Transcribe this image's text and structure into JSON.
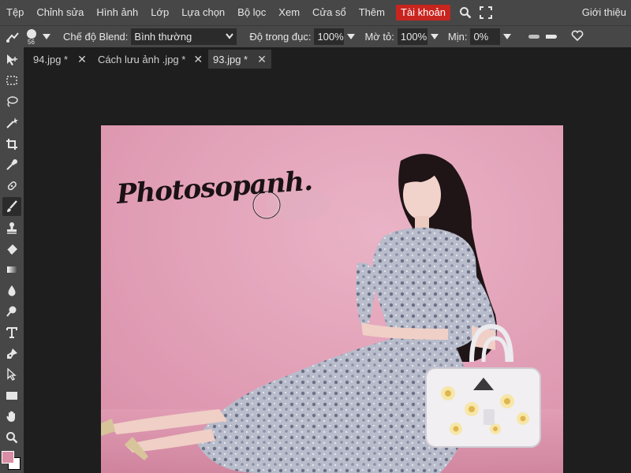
{
  "menu": {
    "items": [
      "Tệp",
      "Chỉnh sửa",
      "Hình ảnh",
      "Lớp",
      "Lựa chọn",
      "Bộ lọc",
      "Xem",
      "Cửa sổ",
      "Thêm"
    ],
    "account": "Tài khoản",
    "about": "Giới thiệu"
  },
  "options": {
    "brush_size": "56",
    "blend_label": "Chế độ Blend:",
    "blend_value": "Bình thường",
    "opacity_label": "Độ trong đục:",
    "opacity_value": "100%",
    "flow_label": "Mờ tỏ:",
    "flow_value": "100%",
    "smooth_label": "Mịn:",
    "smooth_value": "0%"
  },
  "tabs": [
    {
      "label": "94.jpg *"
    },
    {
      "label": "Cách lưu ảnh .jpg *"
    },
    {
      "label": "93.jpg *"
    }
  ],
  "document": {
    "watermark_text": "Photosopanh.",
    "background_color": "#e6a6bd"
  },
  "colors": {
    "foreground": "#d98ea6",
    "background": "#ffffff",
    "account_accent": "#c8251f"
  },
  "tools": [
    "move-icon",
    "marquee-icon",
    "lasso-icon",
    "magic-wand-icon",
    "crop-icon",
    "eyedropper-icon",
    "healing-icon",
    "brush-icon",
    "stamp-icon",
    "eraser-icon",
    "gradient-icon",
    "blur-icon",
    "dodge-icon",
    "type-icon",
    "pen-icon",
    "path-select-icon",
    "rectangle-icon",
    "hand-icon",
    "zoom-icon"
  ]
}
